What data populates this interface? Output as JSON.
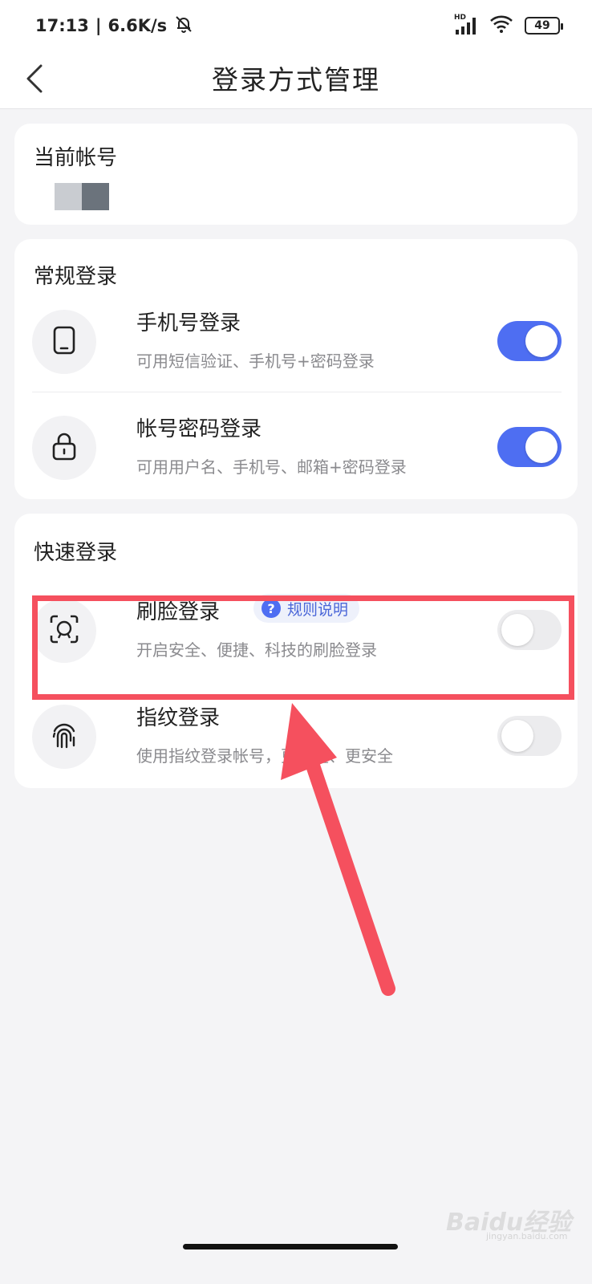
{
  "status_bar": {
    "time": "17:13",
    "speed": "6.6K/s",
    "network_tag": "HD",
    "battery": "49"
  },
  "header": {
    "title": "登录方式管理",
    "back_icon": "chevron-left-icon"
  },
  "current_account": {
    "title": "当前帐号",
    "masked_colors": [
      "#c9ccd1",
      "#6b737c"
    ]
  },
  "regular_login": {
    "title": "常规登录",
    "items": [
      {
        "title": "手机号登录",
        "subtitle": "可用短信验证、手机号+密码登录",
        "enabled": true,
        "icon": "phone-icon"
      },
      {
        "title": "帐号密码登录",
        "subtitle": "可用用户名、手机号、邮箱+密码登录",
        "enabled": true,
        "icon": "lock-icon"
      }
    ]
  },
  "quick_login": {
    "title": "快速登录",
    "items": [
      {
        "title": "刷脸登录",
        "badge": "规则说明",
        "subtitle": "开启安全、便捷、科技的刷脸登录",
        "enabled": false,
        "icon": "face-scan-icon"
      },
      {
        "title": "指纹登录",
        "subtitle": "使用指纹登录帐号，更便捷、更安全",
        "enabled": false,
        "icon": "fingerprint-icon"
      }
    ]
  },
  "colors": {
    "accent": "#4e6ef2",
    "annotation_red": "#f5505e"
  },
  "watermark": {
    "brand": "Baidu经验",
    "url": "jingyan.baidu.com"
  }
}
